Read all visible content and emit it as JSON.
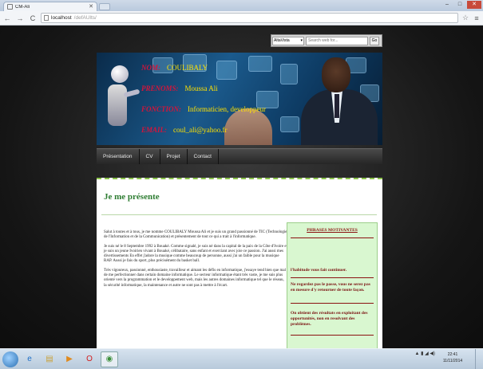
{
  "browser": {
    "tab_title": "CM-Ali",
    "url_host": "localhost",
    "url_path": "/defAUlts/",
    "back": "←",
    "forward": "→",
    "reload": "C",
    "star_icon": "☆",
    "menu_icon": "≡",
    "min": "–",
    "max": "□",
    "close": "✕"
  },
  "search": {
    "engine": "AltaVista",
    "placeholder": "Search web for...",
    "go": "Go"
  },
  "banner": {
    "rows": [
      {
        "label": "NOM:",
        "value": "COULIBALY"
      },
      {
        "label": "PRENOMS:",
        "value": "Moussa  Ali"
      },
      {
        "label": "FONCTION:",
        "value": "Informaticien, developpeur"
      },
      {
        "label": "EMAIL:",
        "value": "coul_ali@yahoo.fr"
      }
    ]
  },
  "nav": [
    "Présentation",
    "CV",
    "Projet",
    "Contact"
  ],
  "main": {
    "heading": "Je me présente",
    "paragraphs": [
      "Salut à toutes et à tous, je me nomme COULIBALY Moussa Ali et je suis un grand passionné de TIC (Technologie de l'Information et de la Communication) et présentement de tout ce qui a trait à l'informatique.",
      "Je suis né le 8 Septembre 1992 à Bouaké. Comme signalé, je suis né dans la capital de la paix de la Côte d'Ivoire et je suis un jeune Ivoirien vivant à Bouaké, célibataire, sans enfant et exerciant avec joie ce passion. J'ai aussi mes divertissements En effet j'adore la musique comme beaucoup de personne, aussi j'ai un faible pour la musique RAP. Aussi je fais du sport, plus précisément du basket ball.",
      "Très vigoureux, passionné, enthousiaste, travailleur et aimant les défis en informatique, j'essaye tend bien que mal de me perfectionner dans certain domaine informatique. Le secteur informatique étant très vaste, je me suis plus orienté vers la programmation et le developpement web, mais les autres domaines informatique tel que le réseau, la sécurité informatique, la maintenance et autre ne sont pas à mettre à l'écart."
    ]
  },
  "sidebar": {
    "title": "PHRASES MOTIVANTES",
    "quotes": [
      "l'habitude vous fait continuer.",
      "Ne regardez pas le passe, vous ne serez pas en mesure d'y retourner de toute façon.",
      "On obtient des résultats en exploitant des opportunités, non en resolvant des problèmes."
    ]
  },
  "taskbar": {
    "time": "22:41",
    "date": "11/11/2014",
    "tray": "▲ ▮ ◢ ◀)"
  }
}
